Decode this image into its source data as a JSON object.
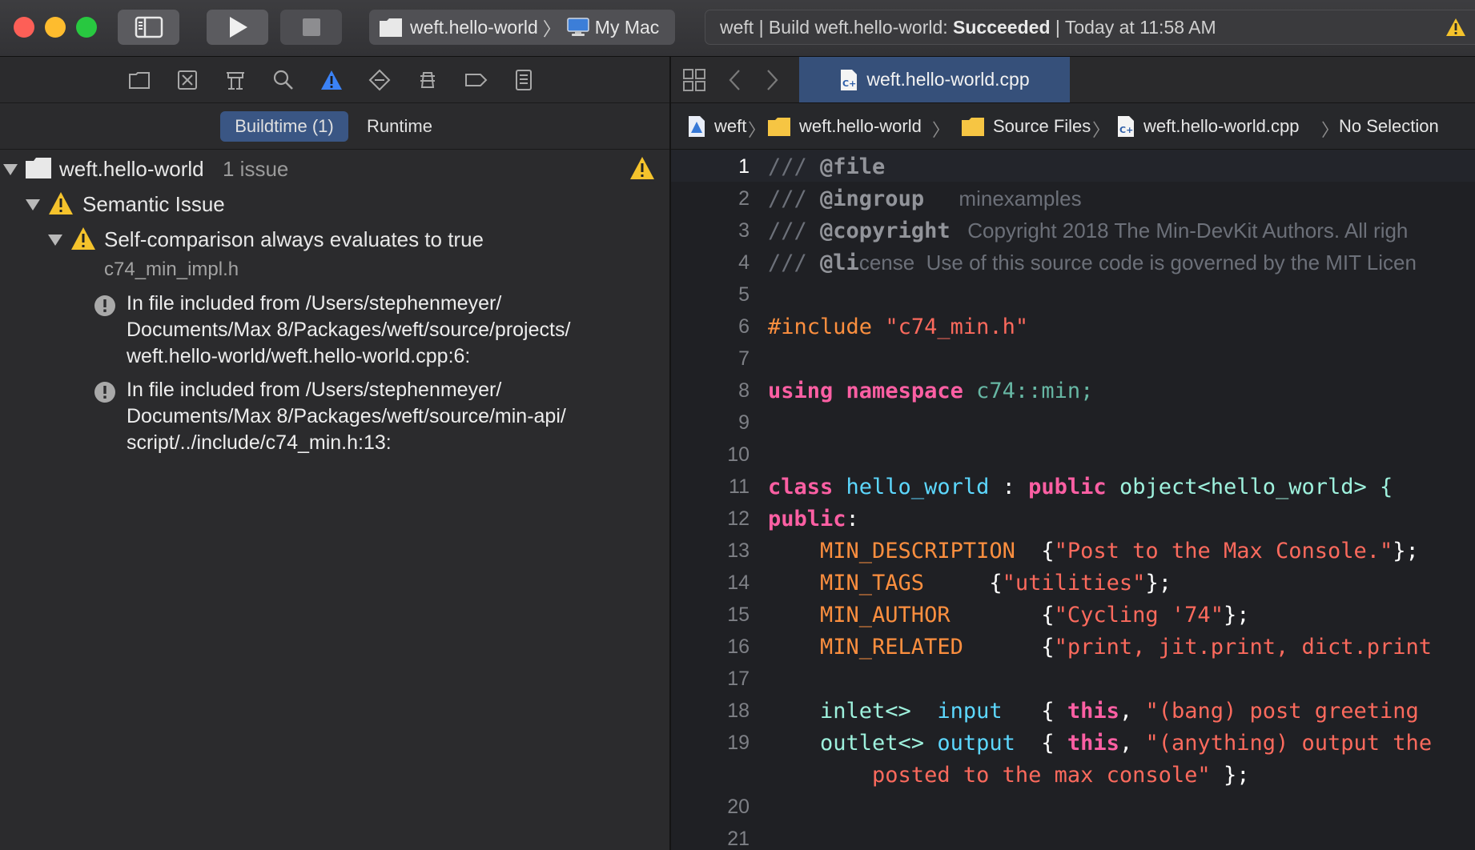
{
  "toolbar": {
    "scheme_target": "weft.hello-world",
    "scheme_device": "My Mac",
    "activity_prefix": "weft | Build weft.hello-world: ",
    "activity_status": "Succeeded",
    "activity_suffix": " | Today at 11:58 AM"
  },
  "navigator": {
    "scope_buildtime": "Buildtime (1)",
    "scope_runtime": "Runtime",
    "project_name": "weft.hello-world",
    "project_count": "1 issue",
    "group_name": "Semantic Issue",
    "issue_title": "Self-comparison always evaluates to true",
    "issue_file": "c74_min_impl.h",
    "note1": "In file included from /Users/stephenmeyer/\nDocuments/Max 8/Packages/weft/source/projects/\nweft.hello-world/weft.hello-world.cpp:6:",
    "note2": "In file included from /Users/stephenmeyer/\nDocuments/Max 8/Packages/weft/source/min-api/\nscript/../include/c74_min.h:13:"
  },
  "editor": {
    "tab_label": "weft.hello-world.cpp",
    "breadcrumbs": [
      "weft",
      "weft.hello-world",
      "Source Files",
      "weft.hello-world.cpp",
      "No Selection"
    ],
    "line_numbers": [
      "1",
      "2",
      "3",
      "4",
      "5",
      "6",
      "7",
      "8",
      "9",
      "10",
      "11",
      "12",
      "13",
      "14",
      "15",
      "16",
      "17",
      "18",
      "19",
      "20",
      "21"
    ],
    "code": {
      "l1_a": "/// ",
      "l1_b": "@file",
      "l2_a": "/// ",
      "l2_b": "@ingroup",
      "l2_c": "      minexamples",
      "l3_a": "/// ",
      "l3_b": "@copyright",
      "l3_c": "   Copyright 2018 The Min-DevKit Authors. All righ",
      "l4_a": "/// ",
      "l4_b": "@li",
      "l4_c": "cense  Use of this source code is governed by the MIT Licen",
      "l6_a": "#include ",
      "l6_b": "\"c74_min.h\"",
      "l8_a": "using",
      "l8_b": " ",
      "l8_c": "namespace",
      "l8_d": " c74::min;",
      "l11_a": "class",
      "l11_b": " hello_world",
      "l11_c": " : ",
      "l11_d": "public",
      "l11_e": " object<hello_world> {",
      "l12_a": "public",
      "l12_b": ":",
      "l13_a": "    MIN_DESCRIPTION",
      "l13_b": "  {",
      "l13_c": "\"Post to the Max Console.\"",
      "l13_d": "};",
      "l14_a": "    MIN_TAGS",
      "l14_b": "     {",
      "l14_c": "\"utilities\"",
      "l14_d": "};",
      "l15_a": "    MIN_AUTHOR",
      "l15_b": "       {",
      "l15_c": "\"Cycling '74\"",
      "l15_d": "};",
      "l16_a": "    MIN_RELATED",
      "l16_b": "      {",
      "l16_c": "\"print, jit.print, dict.print",
      "l18_a": "    inlet<>",
      "l18_b": "  input",
      "l18_c": "   { ",
      "l18_d": "this",
      "l18_e": ", ",
      "l18_f": "\"(bang) post greeting",
      "l19_a": "    outlet<>",
      "l19_b": " output",
      "l19_c": "  { ",
      "l19_d": "this",
      "l19_e": ", ",
      "l19_f": "\"(anything) output the",
      "l19w_a": "        posted to the max console\"",
      "l19w_b": " };"
    }
  },
  "colors": {
    "accent": "#36507a",
    "warning": "#f5c32c",
    "keyword": "#fc5fa3",
    "string": "#fc6a5d",
    "preprocessor": "#fd8f3f"
  }
}
